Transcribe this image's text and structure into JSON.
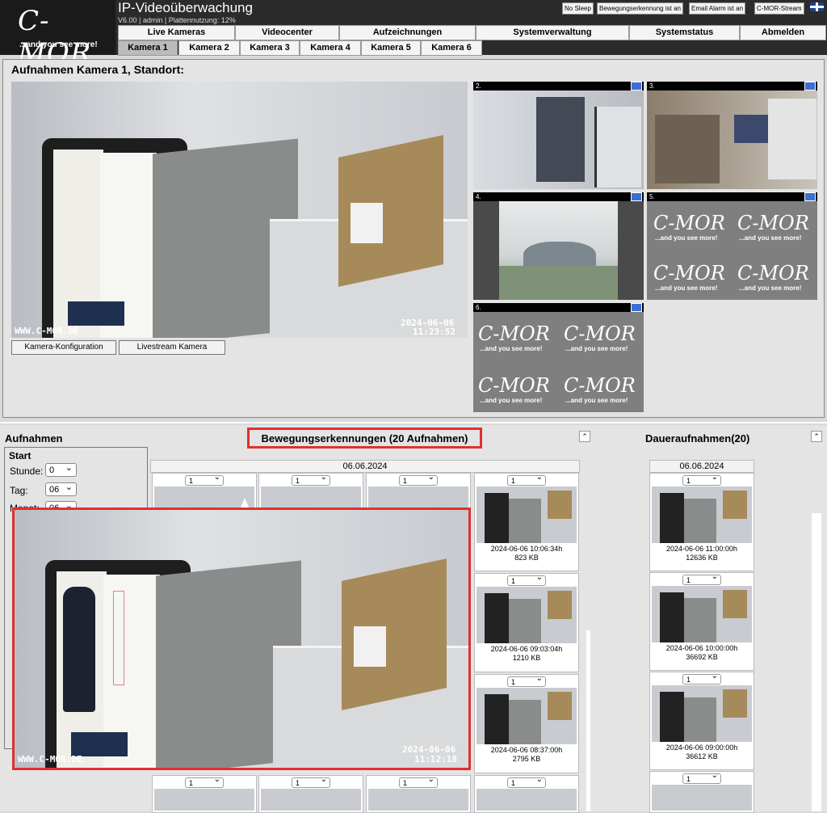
{
  "header": {
    "logo_big": "C-MOR",
    "logo_small": "...and you see more!",
    "title": "IP-Videoüberwachung",
    "meta": "V6.00 | admin | Plattennutzung: 12%",
    "buttons": [
      "No Sleep",
      "Bewegungserkennung ist an",
      "Email Alarm ist an",
      "C-MOR-Stream"
    ],
    "flag_icon": "uk-flag-icon"
  },
  "menu": [
    "Live Kameras",
    "Videocenter",
    "Aufzeichnungen",
    "Systemverwaltung",
    "Systemstatus",
    "Abmelden"
  ],
  "camera_tabs": [
    "Kamera 1",
    "Kamera 2",
    "Kamera 3",
    "Kamera 4",
    "Kamera 5",
    "Kamera 6"
  ],
  "camera_tabs_active": 0,
  "main_panel": {
    "title": "Aufnahmen Kamera 1, Standort:",
    "watermark": "WWW.C-MOR.DE",
    "stamp_date": "2024-06-06",
    "stamp_time": "11:23:52",
    "config_button": "Kamera-Konfiguration",
    "livestream_button": "Livestream Kamera",
    "side_cams": [
      "2.",
      "3.",
      "4.",
      "5.",
      "6."
    ],
    "placeholder_big": "C-MOR",
    "placeholder_small": "...and you see more!"
  },
  "recordings": {
    "heading": "Aufnahmen",
    "start_label": "Start",
    "hour_label": "Stunde:",
    "hour_value": "0",
    "day_label": "Tag:",
    "day_value": "06",
    "month_label": "Monat:",
    "month_value": "06"
  },
  "motion": {
    "heading": "Bewegungserkennungen (20 Aufnahmen)",
    "date": "06.06.2024",
    "select_value": "1",
    "items": [
      {
        "time": "2024-06-06 10:06:34h",
        "size": "823 KB"
      },
      {
        "time": "2024-06-06 09:03:04h",
        "size": "1210 KB"
      },
      {
        "time": "2024-06-06 08:37:00h",
        "size": "2795 KB"
      }
    ]
  },
  "continuous": {
    "heading": "Daueraufnahmen(20)",
    "date": "06.06.2024",
    "select_value": "1",
    "items": [
      {
        "time": "2024-06-06 11:00:00h",
        "size": "12636 KB"
      },
      {
        "time": "2024-06-06 10:00:00h",
        "size": "36692 KB"
      },
      {
        "time": "2024-06-06 09:00:00h",
        "size": "36612 KB"
      }
    ]
  },
  "preview": {
    "watermark": "WWW.C-MOR.DE",
    "stamp_date": "2024-06-06",
    "stamp_time": "11:12:18"
  },
  "colors": {
    "highlight": "#e03030",
    "header_bg": "#2b2b2b"
  }
}
